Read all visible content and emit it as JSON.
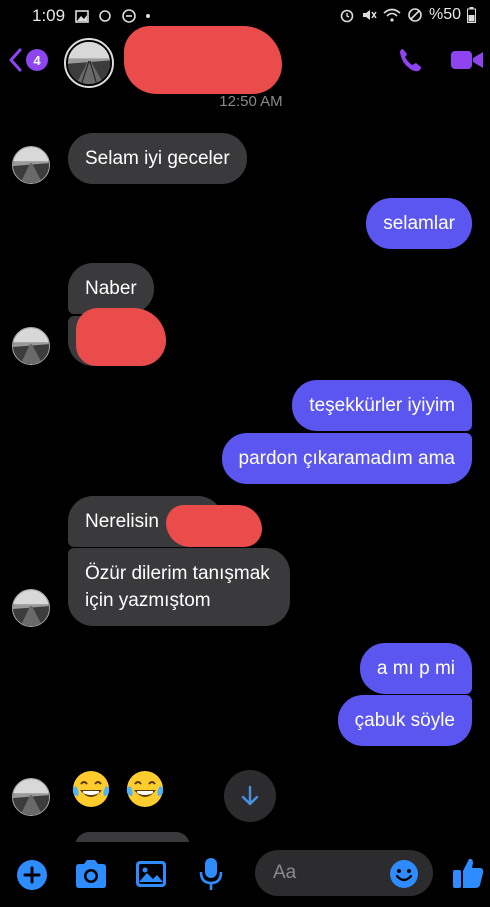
{
  "status_bar": {
    "time": "1:09",
    "battery_text": "%50"
  },
  "header": {
    "back_badge_count": "4",
    "icons": [
      "chevron-left-icon",
      "phone-icon",
      "video-camera-icon"
    ]
  },
  "timestamp": "12:50 AM",
  "messages": [
    {
      "direction": "incoming",
      "text": "Selam iyi geceler"
    },
    {
      "direction": "outgoing",
      "text": "selamlar"
    },
    {
      "direction": "incoming",
      "text": "Naber"
    },
    {
      "direction": "incoming",
      "text": ""
    },
    {
      "direction": "outgoing",
      "text": "teşekkürler iyiyim"
    },
    {
      "direction": "outgoing",
      "text": "pardon çıkaramadım ama"
    },
    {
      "direction": "incoming",
      "text": "Nerelisin"
    },
    {
      "direction": "incoming",
      "text_line1": "Özür dilerim tanışmak",
      "text_line2": "için yazmıştom"
    },
    {
      "direction": "outgoing",
      "text": "a mı p mi"
    },
    {
      "direction": "outgoing",
      "text": "çabuk söyle"
    },
    {
      "direction": "incoming",
      "text": "😂😂"
    }
  ],
  "composer": {
    "placeholder": "Aa",
    "icons": [
      "plus-icon",
      "camera-icon",
      "image-icon",
      "microphone-icon",
      "emoji-icon",
      "thumbs-up-icon"
    ]
  },
  "colors": {
    "background": "#000000",
    "incoming_bubble": "#3a3a3c",
    "outgoing_bubble": "#5a56ef",
    "accent": "#8e44ef",
    "composer_blue": "#2f8cff",
    "redaction": "#ea4b4b"
  }
}
